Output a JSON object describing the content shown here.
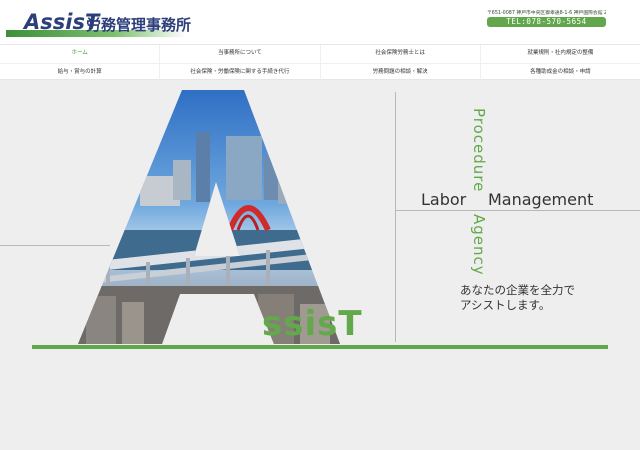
{
  "header": {
    "logo_main": "AssisT",
    "logo_sub": "労務管理事務所",
    "address": "〒651-0087 神戸市中央区御幸通8-1-6 神戸国際会館 22階",
    "tel": "TEL:078-570-5654"
  },
  "nav": {
    "row1": [
      "ホーム",
      "当事務所について",
      "社会保険労務士とは",
      "就業規則・社内規定の整備"
    ],
    "row2": [
      "給与・賞与の計算",
      "社会保険・労働保険に関する手続き代行",
      "労務問題の相談・解決",
      "各種助成金の相談・申請"
    ],
    "active_index": 0
  },
  "hero": {
    "letter_a": "A",
    "assist": "ssisT",
    "procedure": "Procedure",
    "agency": "Agency",
    "labor": "Labor",
    "management": "Management",
    "catch_line1": "あなたの企業を全力で",
    "catch_line2": "アシストします。"
  },
  "colors": {
    "brand_green": "#5fa84c",
    "brand_navy": "#2d3f7a"
  }
}
